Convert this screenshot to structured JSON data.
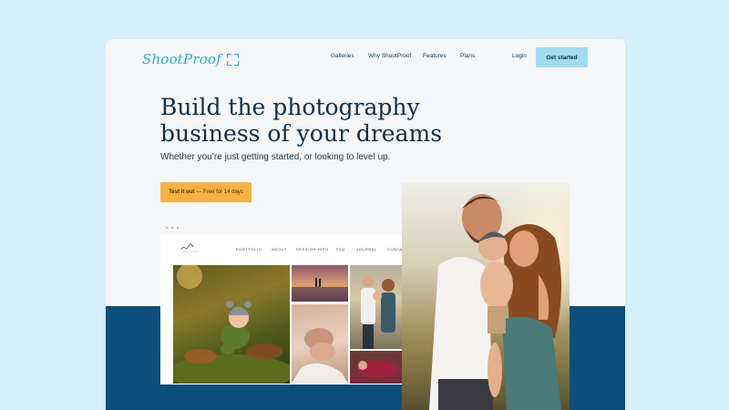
{
  "header": {
    "logo_text": "ShootProof",
    "nav": [
      "Galleries",
      "Why ShootProof",
      "Features",
      "Plans"
    ],
    "login": "Login",
    "cta": "Get started"
  },
  "hero": {
    "headline_line1": "Build the photography",
    "headline_line2": "business of your dreams",
    "subheadline": "Whether you’re just getting started, or looking to level up.",
    "trial_bold": "Test it out",
    "trial_rest": "— Free for 14 days"
  },
  "mock_site": {
    "nav": [
      "PORTFOLIO",
      "ABOUT",
      "SESSION INFO",
      "FAQ",
      "JOURNAL",
      "CONTACT"
    ]
  },
  "colors": {
    "page_bg": "#d6f1fb",
    "accent_teal": "#2fb0c5",
    "cta_bg": "#9fdcef",
    "trial_bg": "#f6b246",
    "band_blue": "#0d4f7a",
    "headline": "#0e2f4d"
  }
}
